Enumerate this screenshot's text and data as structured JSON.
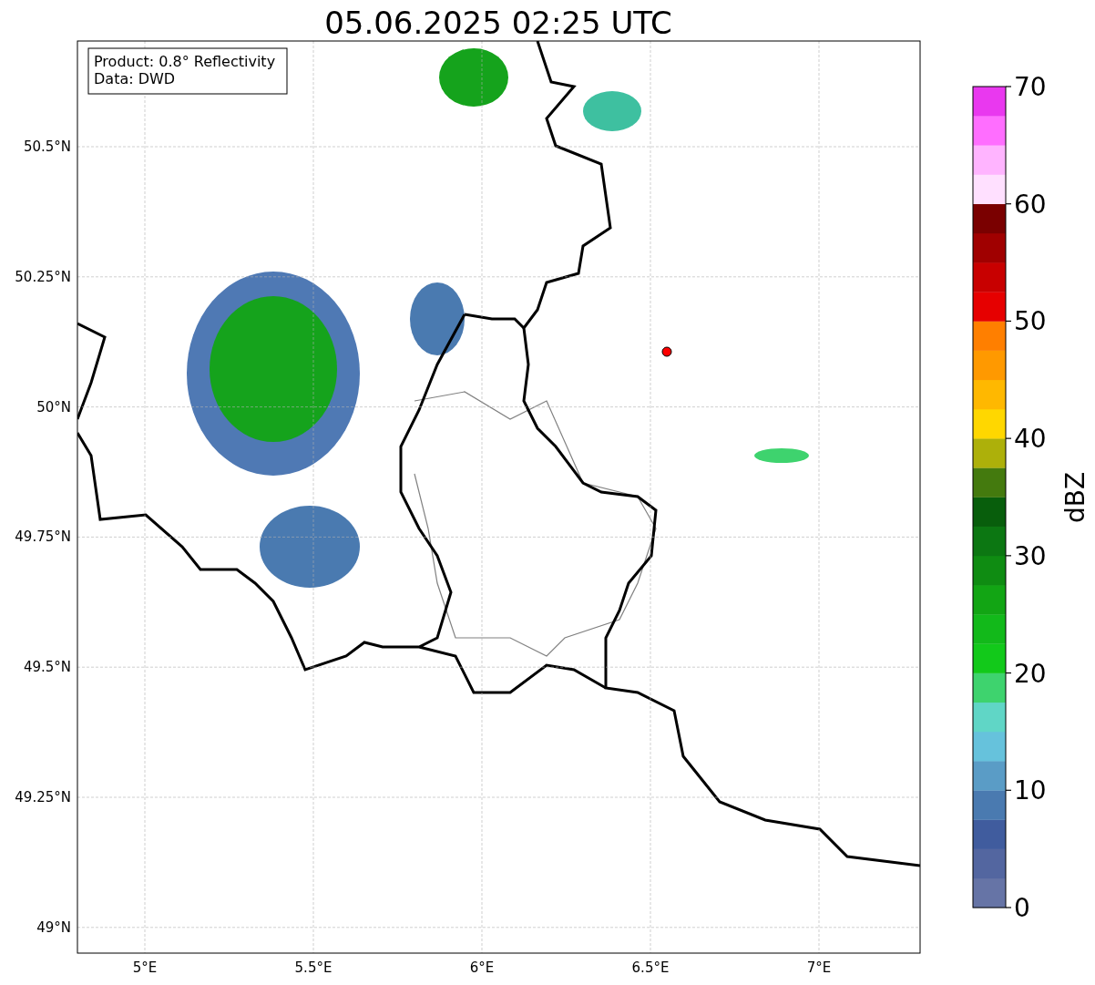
{
  "title": "05.06.2025 02:25 UTC",
  "info_box": [
    "Product: 0.8° Reflectivity",
    "Data: DWD"
  ],
  "map": {
    "x_ticks": [
      "5°E",
      "5.5°E",
      "6°E",
      "6.5°E",
      "7°E"
    ],
    "y_ticks": [
      "50.5°N",
      "50.25°N",
      "50°N",
      "49.75°N",
      "49.5°N",
      "49.25°N",
      "49°N"
    ]
  },
  "colorbar": {
    "label": "dBZ",
    "ticks": [
      "70",
      "60",
      "50",
      "40",
      "30",
      "20",
      "10",
      "0"
    ],
    "bands": [
      {
        "color": "#6674a6"
      },
      {
        "color": "#5366a0"
      },
      {
        "color": "#405c9e"
      },
      {
        "color": "#4a7ab0"
      },
      {
        "color": "#5a9cc6"
      },
      {
        "color": "#66c2dc"
      },
      {
        "color": "#60d6c6"
      },
      {
        "color": "#3ed36e"
      },
      {
        "color": "#12c91a"
      },
      {
        "color": "#12b91a"
      },
      {
        "color": "#12a514"
      },
      {
        "color": "#0f8c12"
      },
      {
        "color": "#0c7712"
      },
      {
        "color": "#085e0c"
      },
      {
        "color": "#447a0e"
      },
      {
        "color": "#adb00a"
      },
      {
        "color": "#ffd700"
      },
      {
        "color": "#ffb800"
      },
      {
        "color": "#ff9900"
      },
      {
        "color": "#ff7f00"
      },
      {
        "color": "#e60000"
      },
      {
        "color": "#c80000"
      },
      {
        "color": "#a00000"
      },
      {
        "color": "#7a0000"
      },
      {
        "color": "#ffe0ff"
      },
      {
        "color": "#ffb4ff"
      },
      {
        "color": "#ff6eff"
      },
      {
        "color": "#e938ef"
      }
    ]
  }
}
